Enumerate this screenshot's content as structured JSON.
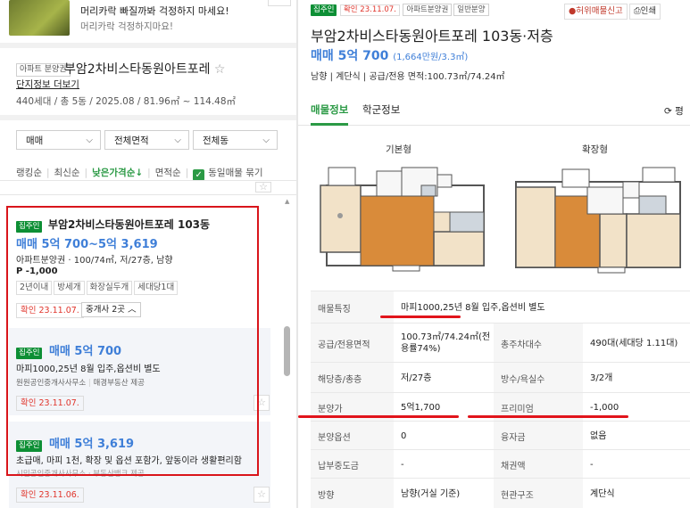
{
  "ad": {
    "line1": "머리카락 빠질까봐 걱정하지 마세요!",
    "line2": "머리카락 걱정하지마요!"
  },
  "complex": {
    "type_badge": "아파트 분양권",
    "name": "부암2차비스타동원아트포레",
    "info_link": "단지정보 더보기",
    "summary": "440세대 / 총 5동 / 2025.08 / 81.96㎡ ~ 114.48㎡"
  },
  "filters": {
    "trade": "매매",
    "area": "전체면적",
    "dong": "전체동"
  },
  "sort": {
    "items": [
      "랭킹순",
      "최신순",
      "낮은가격순↓",
      "면적순"
    ],
    "same_listing_label": "동일매물 묶기"
  },
  "listing": {
    "badge": "집주인",
    "title": "부암2차비스타동원아트포레 103동",
    "price": "매매 5억 700~5억 3,619",
    "desc": "아파트분양권 · 100/74㎡, 저/27층, 남향",
    "premium": "P -1,000",
    "chips": [
      "2년이내",
      "방세개",
      "화장실두개",
      "세대당1대"
    ],
    "confirm": "확인 23.11.07.",
    "agents_btn": "중개사 2곳"
  },
  "sub1": {
    "badge": "집주인",
    "price": "매매 5억 700",
    "desc": "마피1000,25년 8월 입주,옵션비 별도",
    "agent": "원원공인중개사사무소",
    "provider": "매경부동산 제공",
    "confirm": "확인 23.11.07."
  },
  "sub2": {
    "badge": "집주인",
    "price": "매매 5억 3,619",
    "desc": "초급매, 마피 1천, 확장 및 옵션 포함가, 앞동이라 생활편리함",
    "agent": "시민공인중개사사무소 · 부동산뱅크 제공",
    "confirm": "확인 23.11.06."
  },
  "detail": {
    "badge": "집주인",
    "confirm": "확인 23.11.07.",
    "tags": [
      "아파트분양권",
      "일반분양"
    ],
    "report_btn": "허위매물신고",
    "print_btn": "인쇄",
    "title": "부암2차비스타동원아트포레 103동·저층",
    "price": "매매 5억 700",
    "price_per": "(1,664만원/3.3㎡)",
    "info": "남향 | 계단식 | 공급/전용 면적:100.73㎡/74.24㎡",
    "tabs": [
      "매물정보",
      "학군정보"
    ],
    "refresh": "평",
    "plan_basic": "기본형",
    "plan_expand": "확장형",
    "rows": [
      {
        "th1": "매물특징",
        "td1": "마피1000,25년 8월 입주,옵션비 별도"
      },
      {
        "th1": "공급/전용면적",
        "td1": "100.73㎡/74.24㎡(전용률74%)",
        "th2": "총주차대수",
        "td2": "490대(세대당 1.11대)"
      },
      {
        "th1": "해당층/총층",
        "td1": "저/27층",
        "th2": "방수/욕실수",
        "td2": "3/2개"
      },
      {
        "th1": "분양가",
        "td1": "5억1,700",
        "th2": "프리미엄",
        "td2": "-1,000"
      },
      {
        "th1": "분양옵션",
        "td1": "0",
        "th2": "융자금",
        "td2": "없음"
      },
      {
        "th1": "납부중도금",
        "td1": "-",
        "th2": "채권액",
        "td2": "-"
      },
      {
        "th1": "방향",
        "td1": "남향(거실 기준)",
        "th2": "현관구조",
        "td2": "계단식"
      }
    ]
  }
}
